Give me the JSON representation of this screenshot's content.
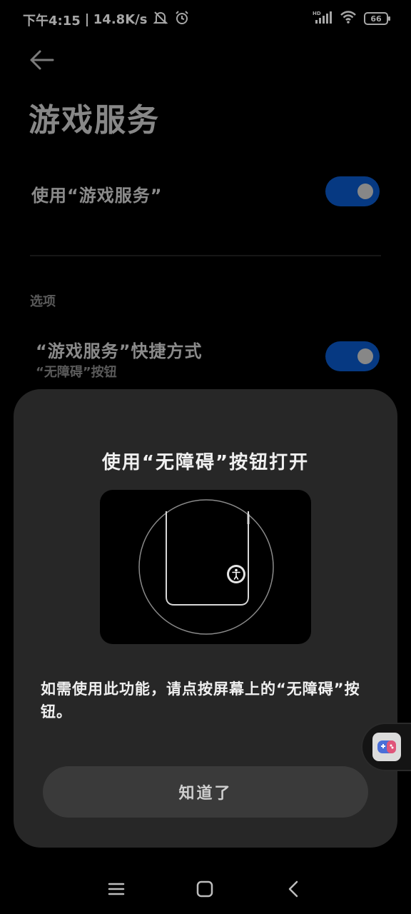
{
  "status_bar": {
    "time": "下午4:15",
    "network_speed": "14.8K/s",
    "battery_level": "66",
    "icons": [
      "mute-icon",
      "alarm-icon",
      "hd-signal-icon",
      "wifi-icon",
      "battery-icon"
    ]
  },
  "header": {
    "title": "游戏服务"
  },
  "settings": {
    "use_service": {
      "label": "使用“游戏服务”",
      "enabled": true
    },
    "section_title": "选项",
    "shortcut": {
      "label": "“游戏服务”快捷方式",
      "sublabel": "“无障碍”按钮",
      "enabled": true
    }
  },
  "dialog": {
    "title": "使用“无障碍”按钮打开",
    "body": "如需使用此功能，请点按屏幕上的“无障碍”按钮。",
    "ok_label": "知道了"
  },
  "colors": {
    "toggle_on": "#0a58c8",
    "dialog_bg": "#272727",
    "button_bg": "#3a3a3a"
  }
}
